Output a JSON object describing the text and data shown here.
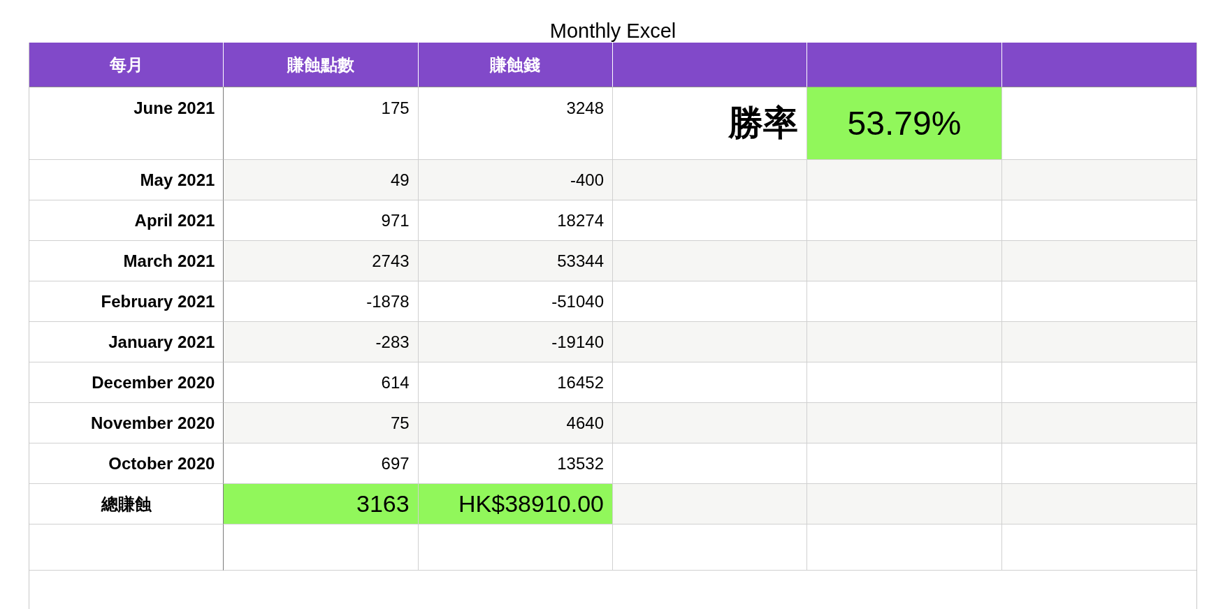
{
  "title": "Monthly Excel",
  "columns": [
    "每月",
    "賺蝕點數",
    "賺蝕錢"
  ],
  "rows": [
    {
      "month": "June 2021",
      "points": "175",
      "money": "3248"
    },
    {
      "month": "May 2021",
      "points": "49",
      "money": "-400"
    },
    {
      "month": "April 2021",
      "points": "971",
      "money": "18274"
    },
    {
      "month": "March 2021",
      "points": "2743",
      "money": "53344"
    },
    {
      "month": "February 2021",
      "points": "-1878",
      "money": "-51040"
    },
    {
      "month": "January 2021",
      "points": "-283",
      "money": "-19140"
    },
    {
      "month": "December 2020",
      "points": "614",
      "money": "16452"
    },
    {
      "month": "November 2020",
      "points": "75",
      "money": "4640"
    },
    {
      "month": "October 2020",
      "points": "697",
      "money": "13532"
    }
  ],
  "win_rate": {
    "label": "勝率",
    "value": "53.79%",
    "highlighted": true
  },
  "total": {
    "label": "總賺蝕",
    "points": "3163",
    "money": "HK$38910.00",
    "highlighted": true
  }
}
